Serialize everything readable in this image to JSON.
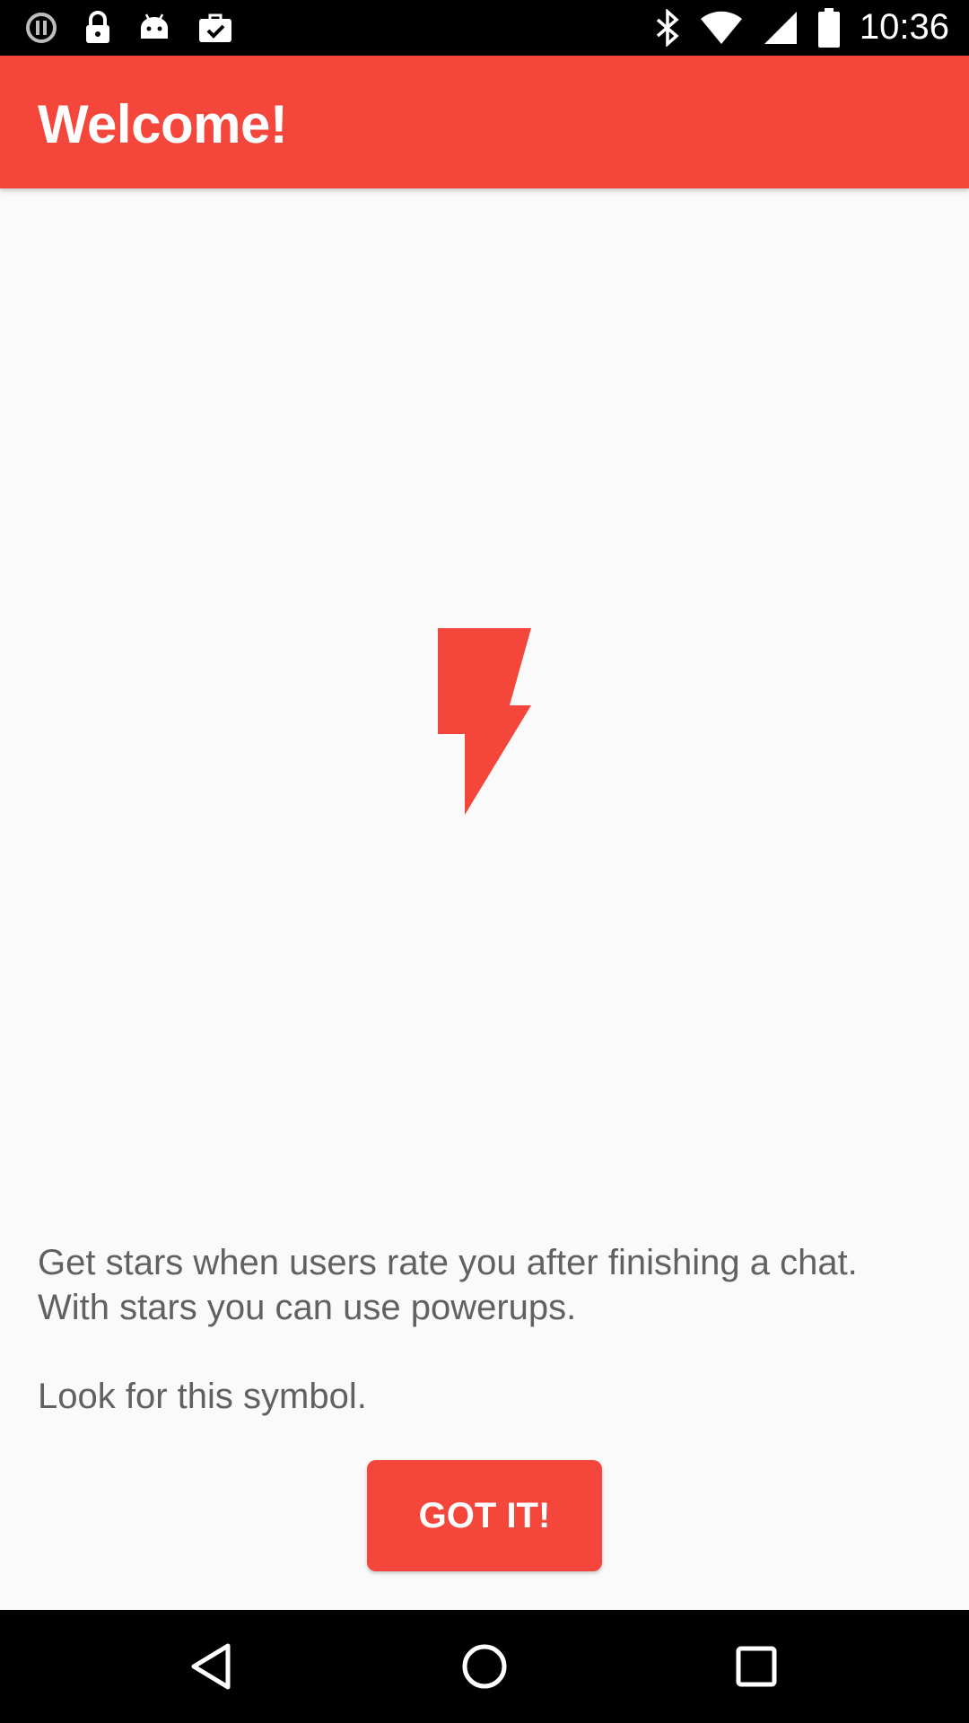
{
  "status_bar": {
    "time": "10:36",
    "left_icons": [
      "circle-info-icon",
      "lock-icon",
      "android-icon",
      "briefcase-check-icon"
    ],
    "right_icons": [
      "bluetooth-icon",
      "wifi-icon",
      "signal-icon",
      "battery-icon"
    ]
  },
  "app_bar": {
    "title": "Welcome!"
  },
  "main": {
    "icon": "lightning-bolt-icon",
    "message_line1": "Get stars when users rate you after finishing a chat.",
    "message_line2": "With stars you can use powerups.",
    "message_line3": "Look for this symbol.",
    "button_label": "GOT IT!"
  },
  "nav_bar": {
    "icons": [
      "back-icon",
      "home-icon",
      "recents-icon"
    ]
  },
  "colors": {
    "accent": "#f4463a",
    "background": "#fafafa",
    "text": "#616161"
  }
}
